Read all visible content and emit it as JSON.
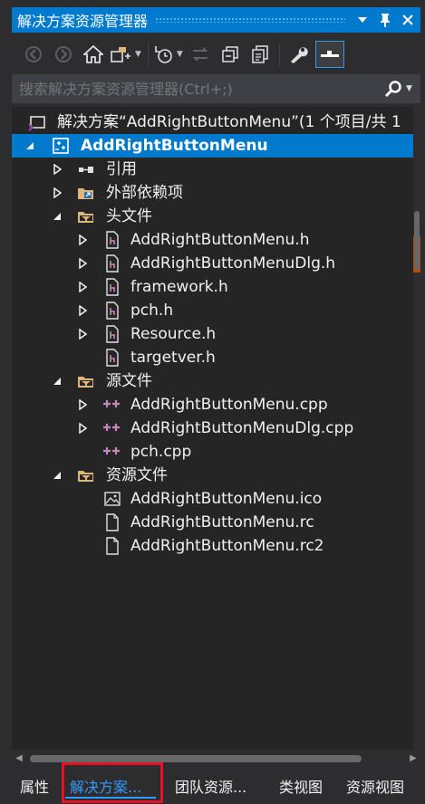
{
  "window": {
    "title": "解决方案资源管理器",
    "pin_icon": "pin-icon",
    "close_icon": "close-icon",
    "dropdown_icon": "dropdown-icon"
  },
  "toolbar": {
    "items": [
      {
        "name": "back-icon",
        "enabled": false
      },
      {
        "name": "forward-icon",
        "enabled": false
      },
      {
        "name": "home-icon",
        "enabled": true
      },
      {
        "name": "switch-views-icon",
        "enabled": true
      },
      {
        "name": "pending-changes-filter-icon",
        "enabled": true
      },
      {
        "name": "sync-active-document-icon",
        "enabled": false
      },
      {
        "name": "collapse-all-icon",
        "enabled": true
      },
      {
        "name": "show-all-files-icon",
        "enabled": true
      },
      {
        "name": "properties-wrench-icon",
        "enabled": true
      },
      {
        "name": "preview-selected-items-icon",
        "enabled": true,
        "active": true
      }
    ]
  },
  "search": {
    "placeholder": "搜索解决方案资源管理器(Ctrl+;)"
  },
  "tree": [
    {
      "id": "solution",
      "label": "解决方案“AddRightButtonMenu”(1 个项目/共 1",
      "icon": "solution-icon",
      "level": 0,
      "arrow": "",
      "selected": false
    },
    {
      "id": "project",
      "label": "AddRightButtonMenu",
      "icon": "cpp-project-icon",
      "level": 1,
      "arrow": "expanded",
      "selected": true
    },
    {
      "id": "references",
      "label": "引用",
      "icon": "references-icon",
      "level": 2,
      "arrow": "collapsed",
      "selected": false
    },
    {
      "id": "external-deps",
      "label": "外部依赖项",
      "icon": "external-dependencies-icon",
      "level": 2,
      "arrow": "collapsed",
      "selected": false
    },
    {
      "id": "header-files",
      "label": "头文件",
      "icon": "filter-folder-icon",
      "level": 2,
      "arrow": "expanded",
      "selected": false
    },
    {
      "id": "h1",
      "label": "AddRightButtonMenu.h",
      "icon": "header-file-icon",
      "level": 3,
      "arrow": "collapsed",
      "selected": false
    },
    {
      "id": "h2",
      "label": "AddRightButtonMenuDlg.h",
      "icon": "header-file-icon",
      "level": 3,
      "arrow": "collapsed",
      "selected": false
    },
    {
      "id": "h3",
      "label": "framework.h",
      "icon": "header-file-icon",
      "level": 3,
      "arrow": "collapsed",
      "selected": false
    },
    {
      "id": "h4",
      "label": "pch.h",
      "icon": "header-file-icon",
      "level": 3,
      "arrow": "collapsed",
      "selected": false
    },
    {
      "id": "h5",
      "label": "Resource.h",
      "icon": "header-file-icon",
      "level": 3,
      "arrow": "collapsed",
      "selected": false
    },
    {
      "id": "h6",
      "label": "targetver.h",
      "icon": "header-file-icon",
      "level": 3,
      "arrow": "",
      "selected": false
    },
    {
      "id": "source-files",
      "label": "源文件",
      "icon": "filter-folder-icon",
      "level": 2,
      "arrow": "expanded",
      "selected": false
    },
    {
      "id": "c1",
      "label": "AddRightButtonMenu.cpp",
      "icon": "cpp-file-icon",
      "level": 3,
      "arrow": "collapsed",
      "selected": false
    },
    {
      "id": "c2",
      "label": "AddRightButtonMenuDlg.cpp",
      "icon": "cpp-file-icon",
      "level": 3,
      "arrow": "collapsed",
      "selected": false
    },
    {
      "id": "c3",
      "label": "pch.cpp",
      "icon": "cpp-file-icon",
      "level": 3,
      "arrow": "",
      "selected": false
    },
    {
      "id": "resource-files",
      "label": "资源文件",
      "icon": "filter-folder-icon",
      "level": 2,
      "arrow": "expanded",
      "selected": false
    },
    {
      "id": "r1",
      "label": "AddRightButtonMenu.ico",
      "icon": "image-file-icon",
      "level": 3,
      "arrow": "",
      "selected": false
    },
    {
      "id": "r2",
      "label": "AddRightButtonMenu.rc",
      "icon": "resource-file-icon",
      "level": 3,
      "arrow": "",
      "selected": false
    },
    {
      "id": "r3",
      "label": "AddRightButtonMenu.rc2",
      "icon": "resource-file-icon",
      "level": 3,
      "arrow": "",
      "selected": false
    }
  ],
  "tabs": [
    {
      "label": "属性",
      "active": false
    },
    {
      "label": "解决方案...",
      "active": true
    },
    {
      "label": "团队资源...",
      "active": false
    },
    {
      "label": "类视图",
      "active": false
    },
    {
      "label": "资源视图",
      "active": false
    }
  ],
  "colors": {
    "accent": "#007acc",
    "active_tab_text": "#3399ff",
    "highlight_box": "#e81123",
    "background": "#252526"
  }
}
